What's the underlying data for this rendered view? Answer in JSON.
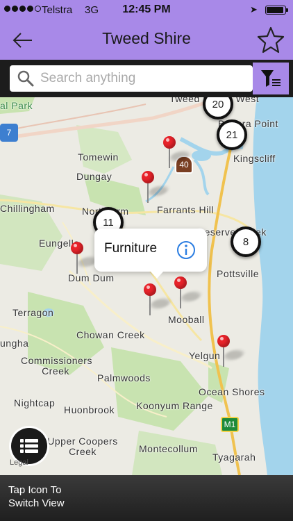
{
  "status_bar": {
    "carrier": "Telstra",
    "network": "3G",
    "time": "12:45 PM"
  },
  "nav": {
    "title": "Tweed Shire",
    "back_icon": "back-arrow-icon",
    "favorite_icon": "star-icon"
  },
  "search": {
    "placeholder": "Search anything",
    "value": "",
    "filter_icon": "filter-list-icon"
  },
  "map": {
    "places": [
      "al Park",
      "Tweed Heads West",
      "Banora Point",
      "Kingscliff",
      "Tomewin",
      "Dungay",
      "Chillingham",
      "North Arm",
      "Farrants Hill",
      "Reserve Creek",
      "Eungella",
      "Dum Dum",
      "Pottsville",
      "Terragon",
      "Chowan Creek",
      "Mooball",
      "ungha",
      "Commissioners Creek",
      "Yelgun",
      "Palmwoods",
      "Ocean Shores",
      "Nightcap",
      "Huonbrook",
      "Koonyum Range",
      "Upper Coopers Creek",
      "Montecollum",
      "Tyagarah",
      "7",
      "40",
      "M1"
    ],
    "clusters": [
      "20",
      "21",
      "11",
      "8"
    ],
    "callout": {
      "label": "Furniture",
      "icon": "info-icon"
    },
    "legal": "Legal",
    "list_icon": "list-view-icon"
  },
  "footer": {
    "hint": "Tap Icon To Switch View"
  },
  "colors": {
    "accent": "#a889e8",
    "pin": "#e8232a",
    "water": "#a3d4ec",
    "park": "#c8e3b0"
  }
}
